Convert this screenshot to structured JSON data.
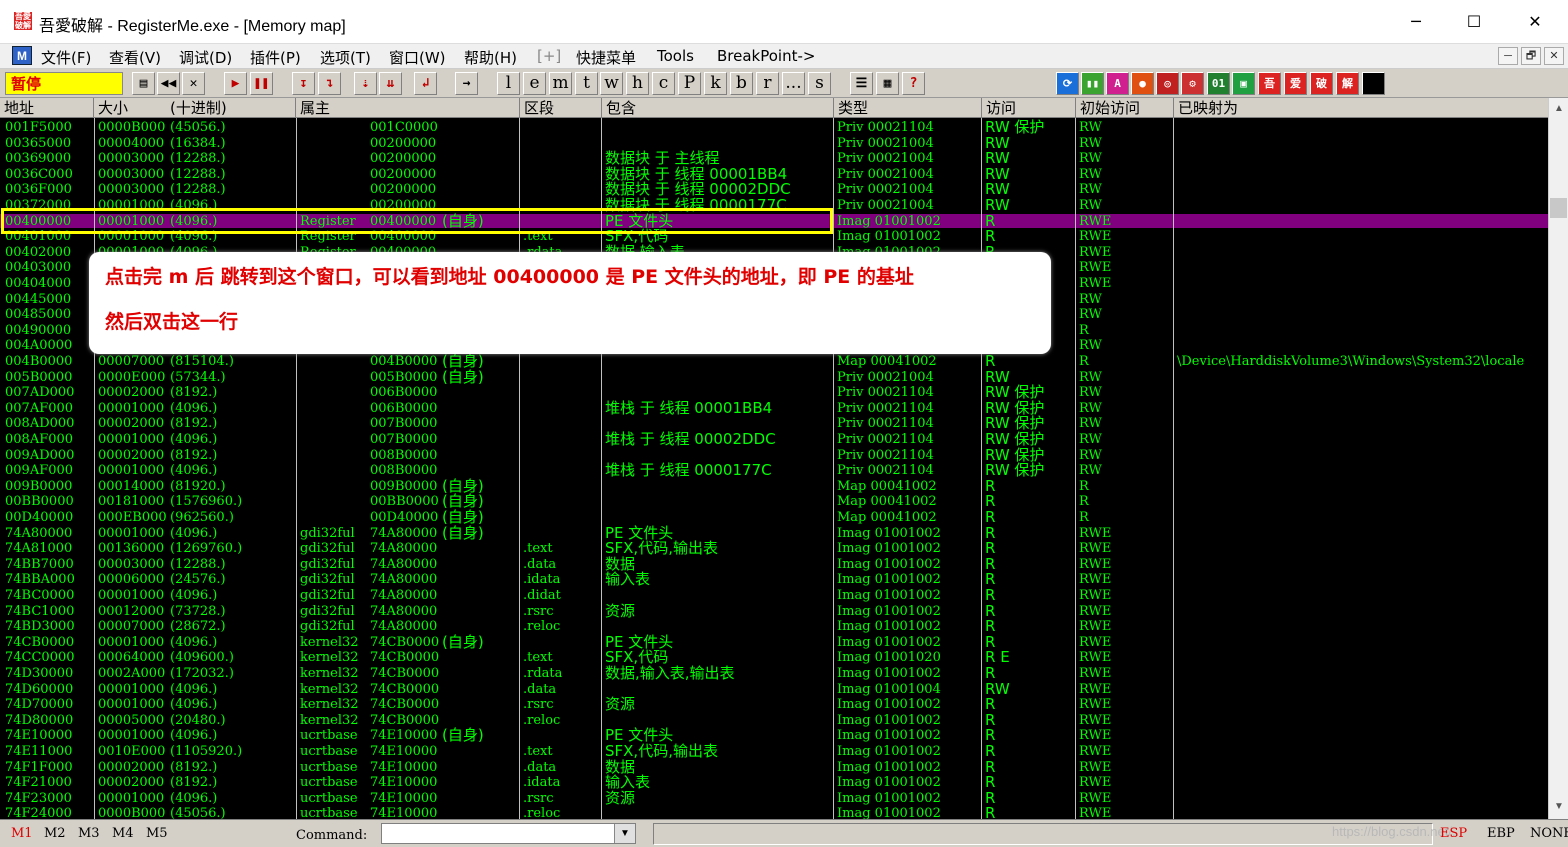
{
  "window": {
    "title": "吾愛破解 - RegisterMe.exe - [Memory map]",
    "app_icon_text": "吾愛破解",
    "minimize": "─",
    "maximize": "☐",
    "close": "✕"
  },
  "menu": {
    "items": [
      "文件(F)",
      "查看(V)",
      "调试(D)",
      "插件(P)",
      "选项(T)",
      "窗口(W)",
      "帮助(H)",
      "[+]",
      "快捷菜单",
      "Tools",
      "BreakPoint->"
    ],
    "mdi_buttons": [
      "─",
      "🗗",
      "✕"
    ],
    "m_icon": "M"
  },
  "toolbar": {
    "status": "暂停",
    "letter_buttons": [
      "l",
      "e",
      "m",
      "t",
      "w",
      "h",
      "c",
      "P",
      "k",
      "b",
      "r",
      "...",
      "s"
    ]
  },
  "columns": [
    "地址",
    "大小",
    "(十进制)",
    "属主",
    "区段",
    "包含",
    "类型",
    "访问",
    "初始访问",
    "已映射为"
  ],
  "rows": [
    {
      "addr": "001F5000",
      "size": "0000B000",
      "dec": "(45056.)",
      "owner": "",
      "base": "001C0000",
      "self": "",
      "section": "",
      "contains": "",
      "type": "Priv 00021104",
      "access": "RW  保护",
      "init": "RW",
      "mapped": ""
    },
    {
      "addr": "00365000",
      "size": "00004000",
      "dec": "(16384.)",
      "owner": "",
      "base": "00200000",
      "self": "",
      "section": "",
      "contains": "",
      "type": "Priv 00021004",
      "access": "RW",
      "init": "RW",
      "mapped": ""
    },
    {
      "addr": "00369000",
      "size": "00003000",
      "dec": "(12288.)",
      "owner": "",
      "base": "00200000",
      "self": "",
      "section": "",
      "contains": "数据块 于 主线程",
      "type": "Priv 00021004",
      "access": "RW",
      "init": "RW",
      "mapped": ""
    },
    {
      "addr": "0036C000",
      "size": "00003000",
      "dec": "(12288.)",
      "owner": "",
      "base": "00200000",
      "self": "",
      "section": "",
      "contains": "数据块 于 线程   00001BB4",
      "type": "Priv 00021004",
      "access": "RW",
      "init": "RW",
      "mapped": ""
    },
    {
      "addr": "0036F000",
      "size": "00003000",
      "dec": "(12288.)",
      "owner": "",
      "base": "00200000",
      "self": "",
      "section": "",
      "contains": "数据块 于 线程   00002DDC",
      "type": "Priv 00021004",
      "access": "RW",
      "init": "RW",
      "mapped": ""
    },
    {
      "addr": "00372000",
      "size": "00001000",
      "dec": "(4096.)",
      "owner": "",
      "base": "00200000",
      "self": "",
      "section": "",
      "contains": "数据块 于 线程   0000177C",
      "type": "Priv 00021004",
      "access": "RW",
      "init": "RW",
      "mapped": ""
    },
    {
      "addr": "00400000",
      "size": "00001000",
      "dec": "(4096.)",
      "owner": "Register",
      "base": "00400000",
      "self": "(自身)",
      "section": "",
      "contains": "PE 文件头",
      "type": "Imag 01001002",
      "access": "R",
      "init": "RWE",
      "mapped": ""
    },
    {
      "addr": "00401000",
      "size": "00001000",
      "dec": "(4096.)",
      "owner": "Register",
      "base": "00400000",
      "self": "",
      "section": ".text",
      "contains": "SFX,代码",
      "type": "Imag 01001002",
      "access": "R",
      "init": "RWE",
      "mapped": ""
    },
    {
      "addr": "00402000",
      "size": "00001000",
      "dec": "(4096.)",
      "owner": "Register",
      "base": "00400000",
      "self": "",
      "section": ".rdata",
      "contains": "数据,输入表",
      "type": "Imag 01001002",
      "access": "R",
      "init": "RWE",
      "mapped": ""
    },
    {
      "addr": "00403000",
      "size": "",
      "dec": "",
      "owner": "",
      "base": "",
      "self": "",
      "section": "",
      "contains": "",
      "type": "",
      "access": "",
      "init": "RWE",
      "mapped": ""
    },
    {
      "addr": "00404000",
      "size": "",
      "dec": "",
      "owner": "",
      "base": "",
      "self": "",
      "section": "",
      "contains": "",
      "type": "",
      "access": "",
      "init": "RWE",
      "mapped": ""
    },
    {
      "addr": "00445000",
      "size": "",
      "dec": "",
      "owner": "",
      "base": "",
      "self": "",
      "section": "",
      "contains": "",
      "type": "",
      "access": "",
      "init": "RW",
      "mapped": ""
    },
    {
      "addr": "00485000",
      "size": "",
      "dec": "",
      "owner": "",
      "base": "",
      "self": "",
      "section": "",
      "contains": "",
      "type": "",
      "access": "",
      "init": "RW",
      "mapped": ""
    },
    {
      "addr": "00490000",
      "size": "",
      "dec": "",
      "owner": "",
      "base": "",
      "self": "",
      "section": "",
      "contains": "",
      "type": "",
      "access": "",
      "init": "R",
      "mapped": ""
    },
    {
      "addr": "004A0000",
      "size": "",
      "dec": "",
      "owner": "",
      "base": "",
      "self": "",
      "section": "",
      "contains": "",
      "type": "",
      "access": "",
      "init": "RW",
      "mapped": ""
    },
    {
      "addr": "004B0000",
      "size": "00007000",
      "dec": "(815104.)",
      "owner": "",
      "base": "004B0000",
      "self": "(自身)",
      "section": "",
      "contains": "",
      "type": "Map  00041002",
      "access": "R",
      "init": "R",
      "mapped": "\\Device\\HarddiskVolume3\\Windows\\System32\\locale"
    },
    {
      "addr": "005B0000",
      "size": "0000E000",
      "dec": "(57344.)",
      "owner": "",
      "base": "005B0000",
      "self": "(自身)",
      "section": "",
      "contains": "",
      "type": "Priv 00021004",
      "access": "RW",
      "init": "RW",
      "mapped": ""
    },
    {
      "addr": "007AD000",
      "size": "00002000",
      "dec": "(8192.)",
      "owner": "",
      "base": "006B0000",
      "self": "",
      "section": "",
      "contains": "",
      "type": "Priv 00021104",
      "access": "RW  保护",
      "init": "RW",
      "mapped": ""
    },
    {
      "addr": "007AF000",
      "size": "00001000",
      "dec": "(4096.)",
      "owner": "",
      "base": "006B0000",
      "self": "",
      "section": "",
      "contains": "堆栈 于 线程  00001BB4",
      "type": "Priv 00021104",
      "access": "RW  保护",
      "init": "RW",
      "mapped": ""
    },
    {
      "addr": "008AD000",
      "size": "00002000",
      "dec": "(8192.)",
      "owner": "",
      "base": "007B0000",
      "self": "",
      "section": "",
      "contains": "",
      "type": "Priv 00021104",
      "access": "RW  保护",
      "init": "RW",
      "mapped": ""
    },
    {
      "addr": "008AF000",
      "size": "00001000",
      "dec": "(4096.)",
      "owner": "",
      "base": "007B0000",
      "self": "",
      "section": "",
      "contains": "堆栈 于 线程  00002DDC",
      "type": "Priv 00021104",
      "access": "RW  保护",
      "init": "RW",
      "mapped": ""
    },
    {
      "addr": "009AD000",
      "size": "00002000",
      "dec": "(8192.)",
      "owner": "",
      "base": "008B0000",
      "self": "",
      "section": "",
      "contains": "",
      "type": "Priv 00021104",
      "access": "RW  保护",
      "init": "RW",
      "mapped": ""
    },
    {
      "addr": "009AF000",
      "size": "00001000",
      "dec": "(4096.)",
      "owner": "",
      "base": "008B0000",
      "self": "",
      "section": "",
      "contains": "堆栈 于 线程  0000177C",
      "type": "Priv 00021104",
      "access": "RW  保护",
      "init": "RW",
      "mapped": ""
    },
    {
      "addr": "009B0000",
      "size": "00014000",
      "dec": "(81920.)",
      "owner": "",
      "base": "009B0000",
      "self": "(自身)",
      "section": "",
      "contains": "",
      "type": "Map  00041002",
      "access": "R",
      "init": "R",
      "mapped": ""
    },
    {
      "addr": "00BB0000",
      "size": "00181000",
      "dec": "(1576960.)",
      "owner": "",
      "base": "00BB0000",
      "self": "(自身)",
      "section": "",
      "contains": "",
      "type": "Map  00041002",
      "access": "R",
      "init": "R",
      "mapped": ""
    },
    {
      "addr": "00D40000",
      "size": "000EB000",
      "dec": "(962560.)",
      "owner": "",
      "base": "00D40000",
      "self": "(自身)",
      "section": "",
      "contains": "",
      "type": "Map  00041002",
      "access": "R",
      "init": "R",
      "mapped": ""
    },
    {
      "addr": "74A80000",
      "size": "00001000",
      "dec": "(4096.)",
      "owner": "gdi32ful",
      "base": "74A80000",
      "self": "(自身)",
      "section": "",
      "contains": "PE 文件头",
      "type": "Imag 01001002",
      "access": "R",
      "init": "RWE",
      "mapped": ""
    },
    {
      "addr": "74A81000",
      "size": "00136000",
      "dec": "(1269760.)",
      "owner": "gdi32ful",
      "base": "74A80000",
      "self": "",
      "section": ".text",
      "contains": "SFX,代码,输出表",
      "type": "Imag 01001002",
      "access": "R",
      "init": "RWE",
      "mapped": ""
    },
    {
      "addr": "74BB7000",
      "size": "00003000",
      "dec": "(12288.)",
      "owner": "gdi32ful",
      "base": "74A80000",
      "self": "",
      "section": ".data",
      "contains": "数据",
      "type": "Imag 01001002",
      "access": "R",
      "init": "RWE",
      "mapped": ""
    },
    {
      "addr": "74BBA000",
      "size": "00006000",
      "dec": "(24576.)",
      "owner": "gdi32ful",
      "base": "74A80000",
      "self": "",
      "section": ".idata",
      "contains": "输入表",
      "type": "Imag 01001002",
      "access": "R",
      "init": "RWE",
      "mapped": ""
    },
    {
      "addr": "74BC0000",
      "size": "00001000",
      "dec": "(4096.)",
      "owner": "gdi32ful",
      "base": "74A80000",
      "self": "",
      "section": ".didat",
      "contains": "",
      "type": "Imag 01001002",
      "access": "R",
      "init": "RWE",
      "mapped": ""
    },
    {
      "addr": "74BC1000",
      "size": "00012000",
      "dec": "(73728.)",
      "owner": "gdi32ful",
      "base": "74A80000",
      "self": "",
      "section": ".rsrc",
      "contains": "资源",
      "type": "Imag 01001002",
      "access": "R",
      "init": "RWE",
      "mapped": ""
    },
    {
      "addr": "74BD3000",
      "size": "00007000",
      "dec": "(28672.)",
      "owner": "gdi32ful",
      "base": "74A80000",
      "self": "",
      "section": ".reloc",
      "contains": "",
      "type": "Imag 01001002",
      "access": "R",
      "init": "RWE",
      "mapped": ""
    },
    {
      "addr": "74CB0000",
      "size": "00001000",
      "dec": "(4096.)",
      "owner": "kernel32",
      "base": "74CB0000",
      "self": "(自身)",
      "section": "",
      "contains": "PE 文件头",
      "type": "Imag 01001002",
      "access": "R",
      "init": "RWE",
      "mapped": ""
    },
    {
      "addr": "74CC0000",
      "size": "00064000",
      "dec": "(409600.)",
      "owner": "kernel32",
      "base": "74CB0000",
      "self": "",
      "section": ".text",
      "contains": "SFX,代码",
      "type": "Imag 01001020",
      "access": "R E",
      "init": "RWE",
      "mapped": ""
    },
    {
      "addr": "74D30000",
      "size": "0002A000",
      "dec": "(172032.)",
      "owner": "kernel32",
      "base": "74CB0000",
      "self": "",
      "section": ".rdata",
      "contains": "数据,输入表,输出表",
      "type": "Imag 01001002",
      "access": "R",
      "init": "RWE",
      "mapped": ""
    },
    {
      "addr": "74D60000",
      "size": "00001000",
      "dec": "(4096.)",
      "owner": "kernel32",
      "base": "74CB0000",
      "self": "",
      "section": ".data",
      "contains": "",
      "type": "Imag 01001004",
      "access": "RW",
      "init": "RWE",
      "mapped": ""
    },
    {
      "addr": "74D70000",
      "size": "00001000",
      "dec": "(4096.)",
      "owner": "kernel32",
      "base": "74CB0000",
      "self": "",
      "section": ".rsrc",
      "contains": "资源",
      "type": "Imag 01001002",
      "access": "R",
      "init": "RWE",
      "mapped": ""
    },
    {
      "addr": "74D80000",
      "size": "00005000",
      "dec": "(20480.)",
      "owner": "kernel32",
      "base": "74CB0000",
      "self": "",
      "section": ".reloc",
      "contains": "",
      "type": "Imag 01001002",
      "access": "R",
      "init": "RWE",
      "mapped": ""
    },
    {
      "addr": "74E10000",
      "size": "00001000",
      "dec": "(4096.)",
      "owner": "ucrtbase",
      "base": "74E10000",
      "self": "(自身)",
      "section": "",
      "contains": "PE 文件头",
      "type": "Imag 01001002",
      "access": "R",
      "init": "RWE",
      "mapped": ""
    },
    {
      "addr": "74E11000",
      "size": "0010E000",
      "dec": "(1105920.)",
      "owner": "ucrtbase",
      "base": "74E10000",
      "self": "",
      "section": ".text",
      "contains": "SFX,代码,输出表",
      "type": "Imag 01001002",
      "access": "R",
      "init": "RWE",
      "mapped": ""
    },
    {
      "addr": "74F1F000",
      "size": "00002000",
      "dec": "(8192.)",
      "owner": "ucrtbase",
      "base": "74E10000",
      "self": "",
      "section": ".data",
      "contains": "数据",
      "type": "Imag 01001002",
      "access": "R",
      "init": "RWE",
      "mapped": ""
    },
    {
      "addr": "74F21000",
      "size": "00002000",
      "dec": "(8192.)",
      "owner": "ucrtbase",
      "base": "74E10000",
      "self": "",
      "section": ".idata",
      "contains": "输入表",
      "type": "Imag 01001002",
      "access": "R",
      "init": "RWE",
      "mapped": ""
    },
    {
      "addr": "74F23000",
      "size": "00001000",
      "dec": "(4096.)",
      "owner": "ucrtbase",
      "base": "74E10000",
      "self": "",
      "section": ".rsrc",
      "contains": "资源",
      "type": "Imag 01001002",
      "access": "R",
      "init": "RWE",
      "mapped": ""
    },
    {
      "addr": "74F24000",
      "size": "0000B000",
      "dec": "(45056.)",
      "owner": "ucrtbase",
      "base": "74E10000",
      "self": "",
      "section": ".reloc",
      "contains": "",
      "type": "Imag 01001002",
      "access": "R",
      "init": "RWE",
      "mapped": ""
    }
  ],
  "selected_row_address": "00400000",
  "annotation": {
    "line1": "点击完 m 后 跳转到这个窗口，可以看到地址 00400000 是 PE 文件头的地址，即 PE 的基址",
    "line2": "然后双击这一行"
  },
  "statusbar": {
    "tabs": [
      "M1",
      "M2",
      "M3",
      "M4",
      "M5"
    ],
    "command_label": "Command:",
    "command_value": "",
    "registers": [
      "ESP",
      "EBP",
      "NONE"
    ],
    "watermark": "https://blog.csdn.net/..."
  },
  "colors": {
    "grid_bg": "#000000",
    "grid_text": "#00ff00",
    "selected_row": "#800080",
    "highlight": "#ffff00",
    "annotation_text": "#e00000"
  }
}
